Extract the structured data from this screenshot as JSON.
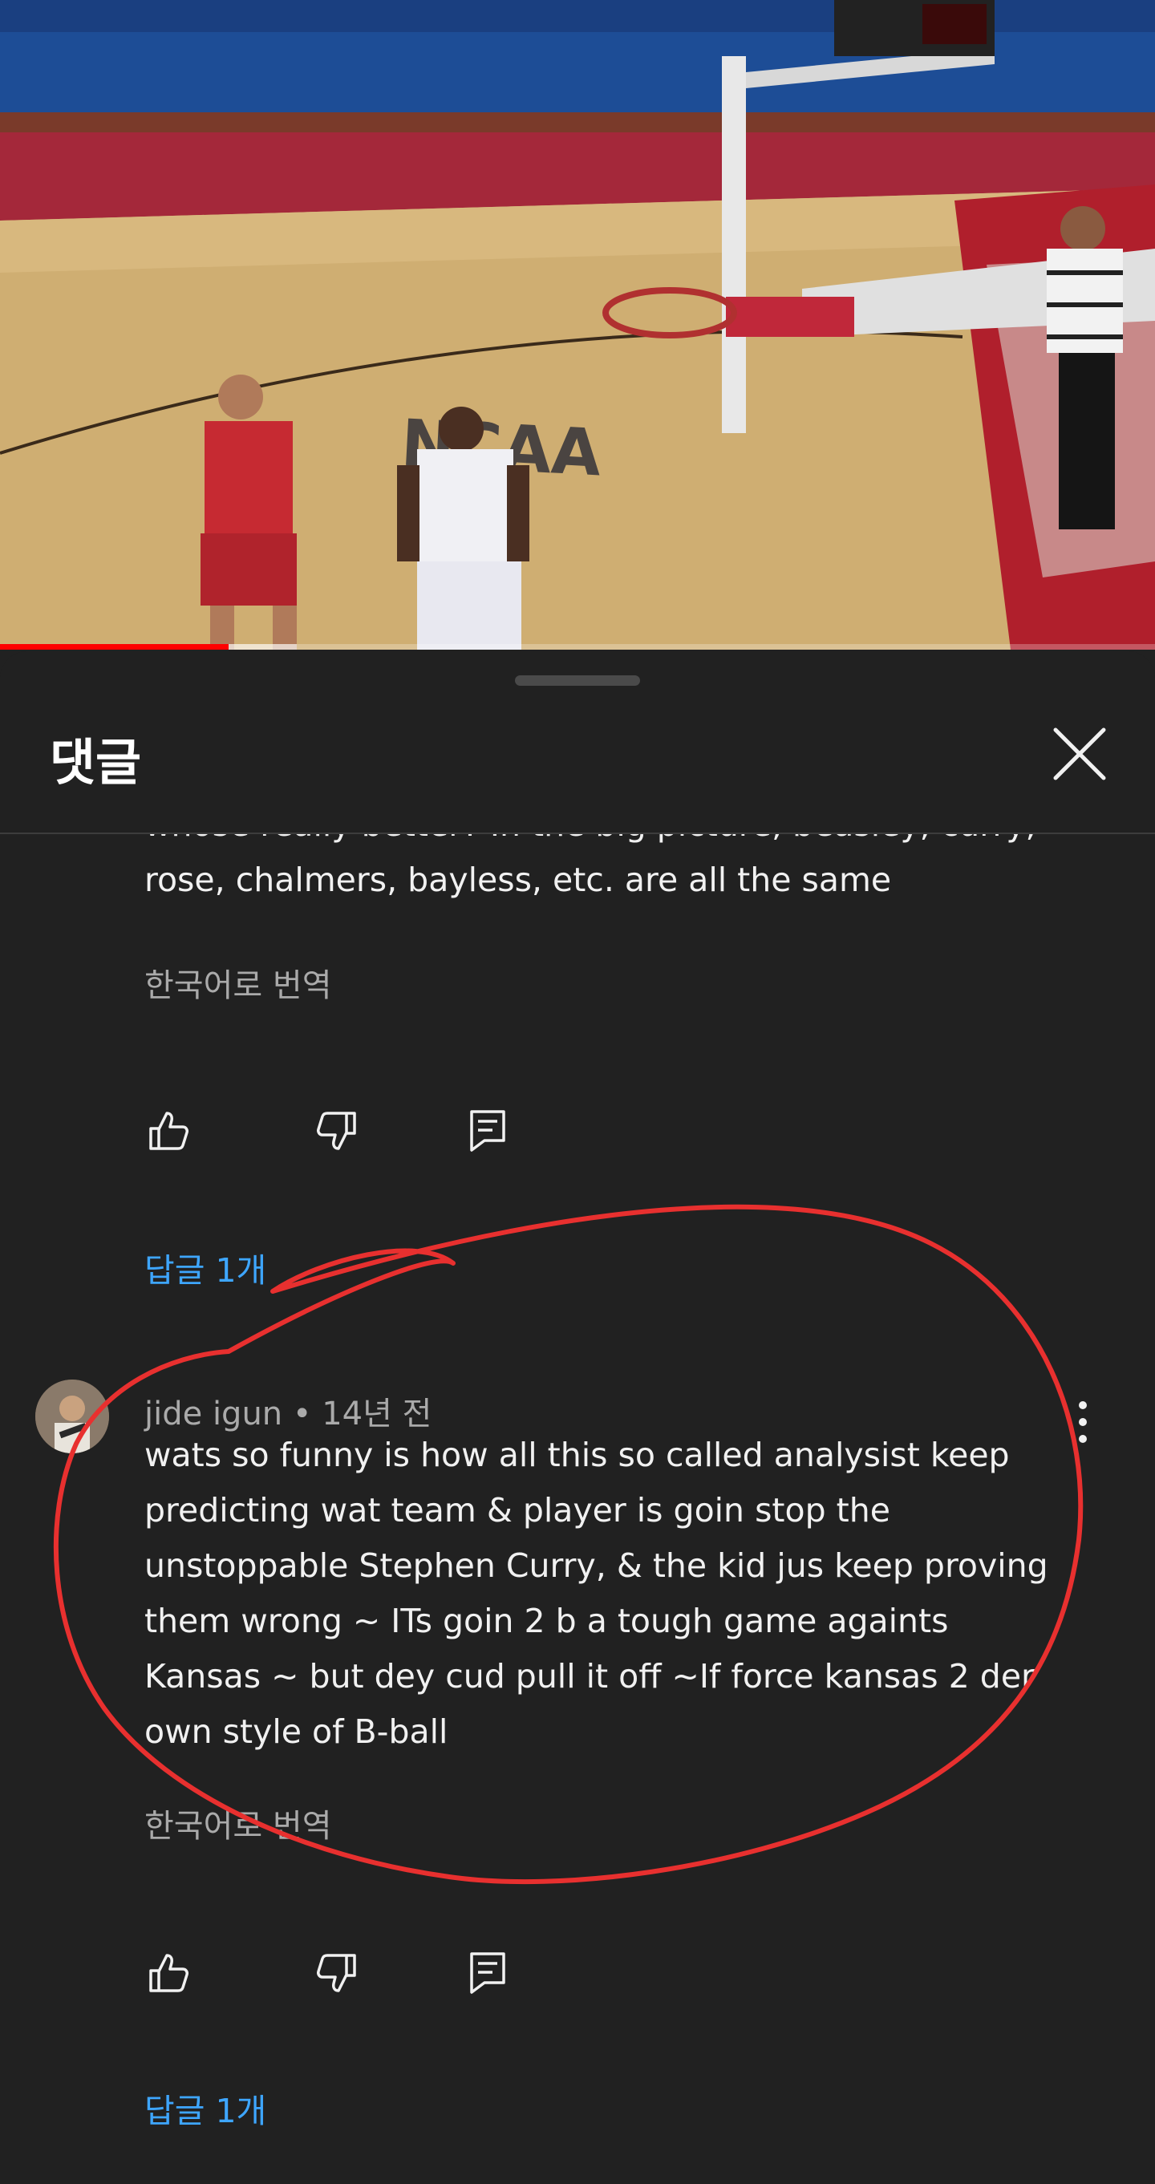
{
  "video": {
    "progress_percent": 19.8,
    "buffered_percent": 25.7
  },
  "sheet": {
    "title": "댓글"
  },
  "comments": [
    {
      "text_partial": "whose really better?  In the big picture, beasley, curry, rose, chalmers, bayless, etc. are all the same",
      "translate_label": "한국어로 번역",
      "replies_label": "답글 1개",
      "icons": [
        "thumbs-up-icon",
        "thumbs-down-icon",
        "reply-icon"
      ]
    },
    {
      "author": "jide igun",
      "separator": "•",
      "time": "14년 전",
      "text": "wats so funny is how all this so called analysist keep predicting wat team & player is goin stop the unstoppable Stephen Curry, & the kid jus keep proving them wrong ~ ITs goin 2 b a tough game againts Kansas ~ but dey cud pull it off ~If force kansas 2 der own style of B-ball",
      "translate_label": "한국어로 번역",
      "replies_label": "답글 1개",
      "icons": [
        "thumbs-up-icon",
        "thumbs-down-icon",
        "reply-icon",
        "more-vert-icon"
      ]
    }
  ],
  "colors": {
    "background": "#212121",
    "link": "#3ea6ff",
    "secondary_text": "#aaaaaa",
    "progress": "#ff0000",
    "annotation": "#e8302f"
  }
}
